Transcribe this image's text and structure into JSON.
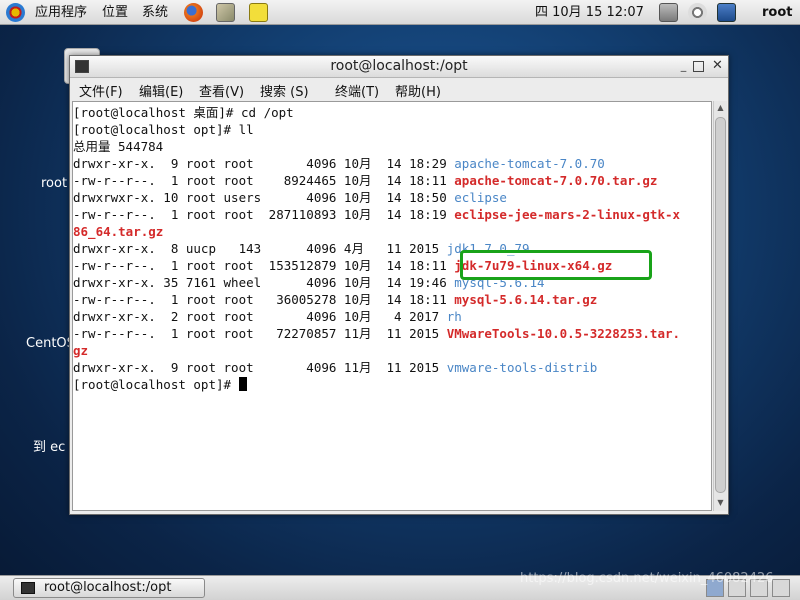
{
  "top_panel": {
    "menus": [
      "应用程序",
      "位置",
      "系统"
    ],
    "clock": "四 10月 15 12:07",
    "user": "root",
    "launchers": [
      "firefox-icon",
      "mail-icon",
      "notes-icon"
    ],
    "tray_icons": [
      "network-icon",
      "volume-icon",
      "display-icon"
    ]
  },
  "desktop": {
    "labels": [
      "root",
      "CentOS",
      "到 ec"
    ]
  },
  "window": {
    "title": "root@localhost:/opt",
    "menu": [
      "文件(F)",
      "编辑(E)",
      "查看(V)",
      "搜索 (S)",
      "终端(T)",
      "帮助(H)"
    ],
    "controls": [
      "minimize-icon",
      "maximize-icon",
      "close-icon"
    ]
  },
  "terminal": {
    "lines": [
      {
        "text": "[root@localhost 桌面]# cd /opt"
      },
      {
        "text": "[root@localhost opt]# ll"
      },
      {
        "text": "总用量 544784"
      },
      {
        "text": "drwxr-xr-x.  9 root root       4096 10月  14 18:29 ",
        "name": "apache-tomcat-7.0.70",
        "kind": "dir"
      },
      {
        "text": "-rw-r--r--.  1 root root    8924465 10月  14 18:11 ",
        "name": "apache-tomcat-7.0.70.tar.gz",
        "kind": "arc"
      },
      {
        "text": "drwxrwxr-x. 10 root users      4096 10月  14 18:50 ",
        "name": "eclipse",
        "kind": "dir"
      },
      {
        "text": "-rw-r--r--.  1 root root  287110893 10月  14 18:19 ",
        "name": "eclipse-jee-mars-2-linux-gtk-x",
        "kind": "arc"
      },
      {
        "text": "",
        "name": "86_64.tar.gz",
        "kind": "arc"
      },
      {
        "text": "drwxr-xr-x.  8 uucp   143      4096 4月   11 2015 ",
        "name": "jdk1.7.0_79",
        "kind": "dir"
      },
      {
        "text": "-rw-r--r--.  1 root root  153512879 10月  14 18:11 ",
        "name": "jdk-7u79-linux-x64.gz",
        "kind": "arc"
      },
      {
        "text": "drwxr-xr-x. 35 7161 wheel      4096 10月  14 19:46 ",
        "name": "mysql-5.6.14",
        "kind": "dir"
      },
      {
        "text": "-rw-r--r--.  1 root root   36005278 10月  14 18:11 ",
        "name": "mysql-5.6.14.tar.gz",
        "kind": "arc"
      },
      {
        "text": "drwxr-xr-x.  2 root root       4096 10月   4 2017 ",
        "name": "rh",
        "kind": "dir"
      },
      {
        "text": "-rw-r--r--.  1 root root   72270857 11月  11 2015 ",
        "name": "VMwareTools-10.0.5-3228253.tar.",
        "kind": "arc"
      },
      {
        "text": "",
        "name": "gz",
        "kind": "arc"
      },
      {
        "text": "drwxr-xr-x.  9 root root       4096 11月  11 2015 ",
        "name": "vmware-tools-distrib",
        "kind": "dir"
      },
      {
        "text": "[root@localhost opt]# ",
        "cursor": true
      }
    ]
  },
  "taskbar": {
    "task_label": "root@localhost:/opt",
    "watermark": "https://blog.csdn.net/weixin_46082426"
  },
  "colors": {
    "dir": "#4a86c6",
    "archive": "#d42a2a",
    "highlight": "#19a319"
  }
}
